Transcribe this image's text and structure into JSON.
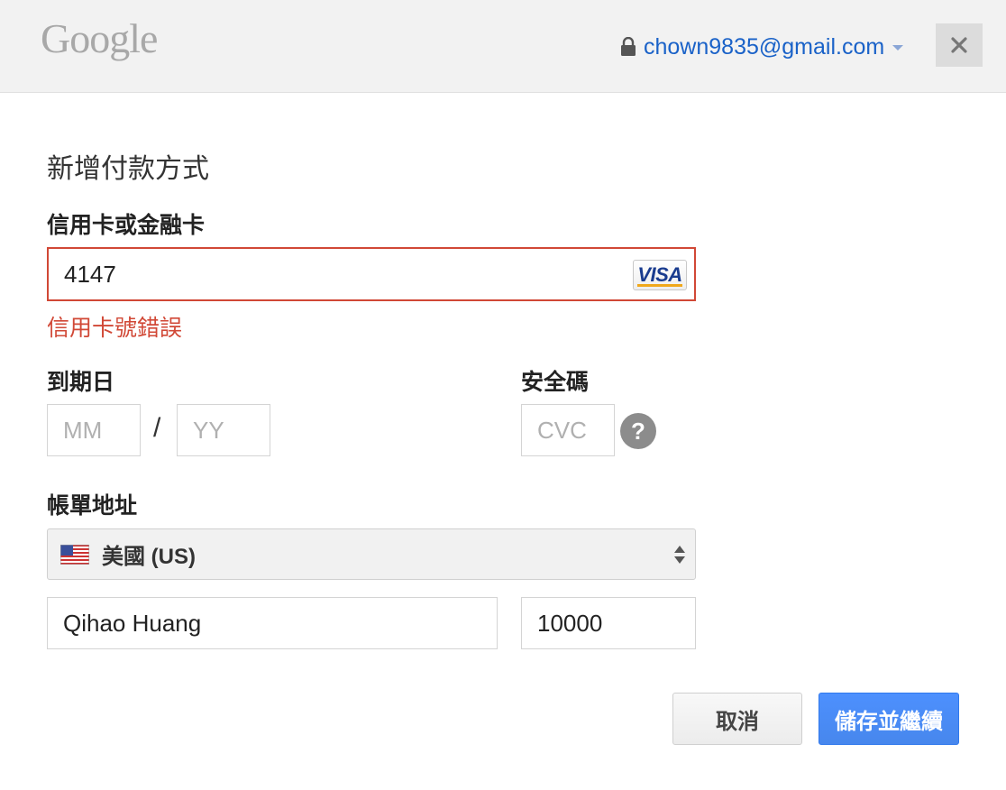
{
  "header": {
    "logo": "Google",
    "account_email": "chown9835@gmail.com",
    "close_label": "✕"
  },
  "form": {
    "title": "新增付款方式",
    "card_label": "信用卡或金融卡",
    "card_number": "4147",
    "card_brand": "VISA",
    "card_error": "信用卡號錯誤",
    "expiry_label": "到期日",
    "month_placeholder": "MM",
    "year_placeholder": "YY",
    "expiry_separator": "/",
    "cvc_label": "安全碼",
    "cvc_placeholder": "CVC",
    "cvc_help": "?",
    "billing_label": "帳單地址",
    "country": "美國 (US)",
    "name_value": "Qihao Huang",
    "zip_value": "10000"
  },
  "actions": {
    "cancel_label": "取消",
    "save_label": "儲存並繼續"
  },
  "colors": {
    "error": "#d14836",
    "link": "#1a62c8",
    "primary": "#4d90fe"
  }
}
